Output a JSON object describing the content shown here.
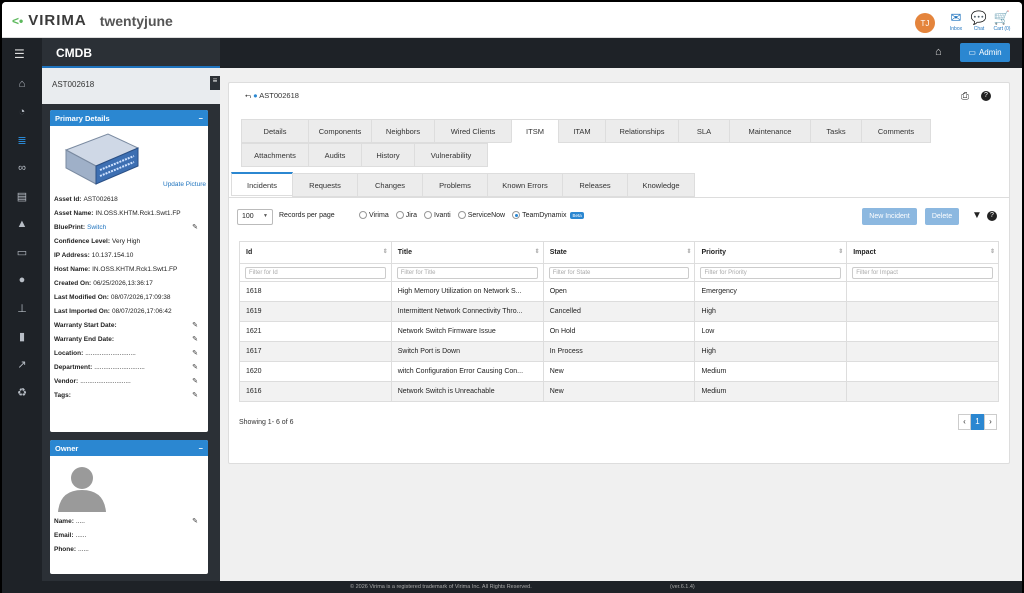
{
  "header": {
    "brand": "VIRIMA",
    "tenant": "twentyjune",
    "avatar": "TJ",
    "icons": [
      {
        "name": "inbox",
        "label": "Inbox"
      },
      {
        "name": "chat",
        "label": "Chat"
      },
      {
        "name": "cart",
        "label": "Cart (0)"
      }
    ]
  },
  "navbar": {
    "module": "CMDB",
    "admin_label": "Admin"
  },
  "rail": [
    "home-icon",
    "dashboard-icon",
    "database-icon",
    "binoculars-icon",
    "window-icon",
    "warning-icon",
    "monitor-icon",
    "user-icon",
    "sitemap-icon",
    "book-icon",
    "chart-icon",
    "recycle-icon"
  ],
  "left": {
    "asset_title": "AST002618",
    "primary": {
      "title": "Primary Details",
      "collapse": "−",
      "update_picture": "Update Picture",
      "rows": [
        {
          "label": "Asset Id:",
          "value": "AST002618"
        },
        {
          "label": "Asset Name:",
          "value": "IN.OSS.KHTM.Rck1.Swt1.FP"
        },
        {
          "label": "BluePrint:",
          "value": "Switch",
          "link": true,
          "pin": true
        },
        {
          "label": "Confidence Level:",
          "value": "Very High"
        },
        {
          "label": "IP Address:",
          "value": "10.137.154.10"
        },
        {
          "label": "Host Name:",
          "value": "IN.OSS.KHTM.Rck1.Swt1.FP"
        },
        {
          "label": "Created On:",
          "value": "06/25/2026,13:36:17"
        },
        {
          "label": "Last Modified On:",
          "value": "08/07/2026,17:09:38"
        },
        {
          "label": "Last Imported On:",
          "value": "08/07/2026,17:06:42"
        },
        {
          "label": "Warranty Start Date:",
          "value": "",
          "pin": true
        },
        {
          "label": "Warranty End Date:",
          "value": "",
          "pin": true
        },
        {
          "label": "Location:",
          "value": "............................",
          "pin": true
        },
        {
          "label": "Department:",
          "value": "............................",
          "pin": true
        },
        {
          "label": "Vendor:",
          "value": "............................",
          "pin": true
        },
        {
          "label": "Tags:",
          "value": "",
          "pin": true
        }
      ]
    },
    "owner": {
      "title": "Owner",
      "collapse": "−",
      "rows": [
        {
          "label": "Name:",
          "value": ".....",
          "pin": true
        },
        {
          "label": "Email:",
          "value": "......"
        },
        {
          "label": "Phone:",
          "value": "......"
        }
      ]
    }
  },
  "main": {
    "breadcrumb": "AST002618",
    "tabs_row1": [
      "Details",
      "Components",
      "Neighbors",
      "Wired Clients",
      "ITSM",
      "ITAM",
      "Relationships",
      "SLA",
      "Maintenance",
      "Tasks",
      "Comments"
    ],
    "tabs_row2": [
      "Attachments",
      "Audits",
      "History",
      "Vulnerability"
    ],
    "active_tab": "ITSM",
    "subtabs": [
      "Incidents",
      "Requests",
      "Changes",
      "Problems",
      "Known Errors",
      "Releases",
      "Knowledge"
    ],
    "active_subtab": "Incidents",
    "records_value": "100",
    "records_label": "Records per page",
    "radios": [
      {
        "label": "Virima",
        "on": false
      },
      {
        "label": "Jira",
        "on": false
      },
      {
        "label": "Ivanti",
        "on": false
      },
      {
        "label": "ServiceNow",
        "on": false
      },
      {
        "label": "TeamDynamix",
        "on": true,
        "beta": "Beta"
      }
    ],
    "new_btn": "New Incident",
    "del_btn": "Delete",
    "columns": [
      {
        "label": "Id",
        "filter": "Filter for Id"
      },
      {
        "label": "Title",
        "filter": "Filter for Title"
      },
      {
        "label": "State",
        "filter": "Filter for State"
      },
      {
        "label": "Priority",
        "filter": "Filter for Priority"
      },
      {
        "label": "Impact",
        "filter": "Filter for Impact"
      }
    ],
    "rows": [
      [
        "1618",
        "High Memory Utilization on Network S...",
        "Open",
        "Emergency",
        ""
      ],
      [
        "1619",
        "Intermittent Network Connectivity Thro...",
        "Cancelled",
        "High",
        ""
      ],
      [
        "1621",
        "Network Switch Firmware Issue",
        "On Hold",
        "Low",
        ""
      ],
      [
        "1617",
        "Switch Port is Down",
        "In Process",
        "High",
        ""
      ],
      [
        "1620",
        "witch Configuration Error Causing Con...",
        "New",
        "Medium",
        ""
      ],
      [
        "1616",
        "Network Switch is Unreachable",
        "New",
        "Medium",
        ""
      ]
    ],
    "showing": "Showing 1- 6 of 6",
    "page": "1"
  },
  "footer": {
    "copyright": "© 2026 Virima is a registered trademark of Virima Inc. All Rights Reserved.",
    "version": "(ver.6.1.4)"
  }
}
